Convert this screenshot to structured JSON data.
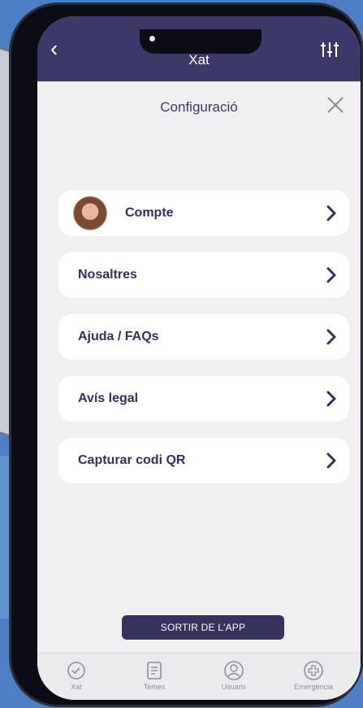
{
  "header": {
    "title": "Xat",
    "back_icon": "chevron-left-icon",
    "filter_icon": "sliders-icon"
  },
  "modal": {
    "title": "Configuració",
    "close_icon": "close-icon"
  },
  "menu": [
    {
      "label": "Compte",
      "has_avatar": true
    },
    {
      "label": "Nosaltres"
    },
    {
      "label": "Ajuda / FAQs"
    },
    {
      "label": "Avís legal"
    },
    {
      "label": "Capturar codi QR"
    }
  ],
  "logout_label": "SORTIR DE L'APP",
  "tabs": [
    {
      "label": "Xat",
      "icon": "chat-icon"
    },
    {
      "label": "Temes",
      "icon": "document-icon"
    },
    {
      "label": "Usuaris",
      "icon": "user-icon"
    },
    {
      "label": "Emergència",
      "icon": "emergency-icon"
    }
  ],
  "colors": {
    "primary": "#3c3869",
    "background": "#4e7fc4",
    "card": "#ffffff"
  }
}
